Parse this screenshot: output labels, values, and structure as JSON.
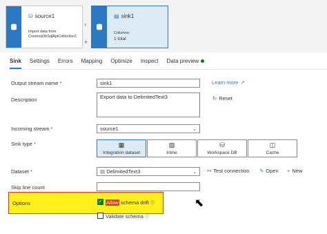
{
  "canvas": {
    "source_node": {
      "title": "source1",
      "description": "Import data from CosmosDbSqlApiCollection1"
    },
    "sink_node": {
      "title": "sink1",
      "columns_label": "Columns:",
      "columns_value": "1 total"
    },
    "add_label": "+"
  },
  "tabs": [
    {
      "label": "Sink",
      "active": true
    },
    {
      "label": "Settings"
    },
    {
      "label": "Errors"
    },
    {
      "label": "Mapping"
    },
    {
      "label": "Optimize"
    },
    {
      "label": "Inspect"
    },
    {
      "label": "Data preview"
    }
  ],
  "form": {
    "output_stream_name": {
      "label": "Output stream name",
      "required": "*",
      "value": "sink1"
    },
    "learn_more": "Learn more",
    "description": {
      "label": "Description",
      "value": "Export data to DelimitedText3"
    },
    "reset": "Reset",
    "incoming_stream": {
      "label": "Incoming stream",
      "required": "*",
      "value": "source1"
    },
    "sink_type": {
      "label": "Sink type",
      "required": "*",
      "options": [
        "Integration dataset",
        "Inline",
        "Workspace DB",
        "Cache"
      ],
      "selected": "Integration dataset"
    },
    "dataset": {
      "label": "Dataset",
      "required": "*",
      "value": "DelimitedText3"
    },
    "test_connection": "Test connection",
    "open": "Open",
    "new": "New",
    "skip_line_count": {
      "label": "Skip line count",
      "value": ""
    },
    "options": {
      "label": "Options",
      "allow_part1": "Allow",
      "allow_part2": " schema drift",
      "validate": "Validate schema"
    }
  },
  "colors": {
    "accent": "#2b79c2",
    "highlight": "#ffef1a",
    "success": "#107c10"
  }
}
